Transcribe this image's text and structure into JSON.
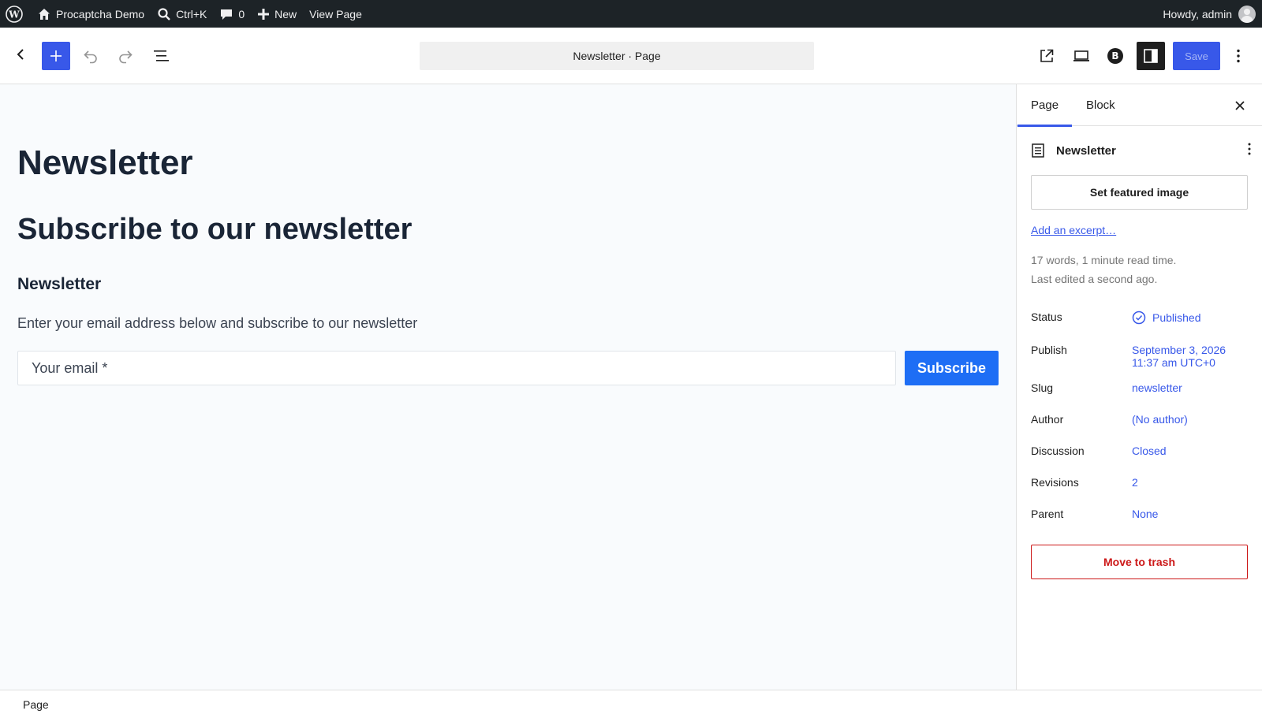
{
  "adminbar": {
    "site_name": "Procaptcha Demo",
    "search_shortcut": "Ctrl+K",
    "comments_count": "0",
    "new_label": "New",
    "view_page": "View Page",
    "greeting": "Howdy, admin"
  },
  "header": {
    "document_title": "Newsletter · Page",
    "save_label": "Save"
  },
  "canvas": {
    "post_title": "Newsletter",
    "heading2": "Subscribe to our newsletter",
    "heading3": "Newsletter",
    "paragraph": "Enter your email address below and subscribe to our newsletter",
    "email_placeholder": "Your email *",
    "subscribe_label": "Subscribe"
  },
  "sidebar": {
    "tabs": [
      {
        "label": "Page",
        "active": true
      },
      {
        "label": "Block",
        "active": false
      }
    ],
    "doc_name": "Newsletter",
    "featured_image_label": "Set featured image",
    "excerpt_link": "Add an excerpt…",
    "stats": "17 words, 1 minute read time.",
    "last_edited": "Last edited a second ago.",
    "properties": [
      {
        "key": "Status",
        "value": "Published"
      },
      {
        "key": "Publish",
        "value": "September 3, 2026",
        "value2": "11:37 am UTC+0"
      },
      {
        "key": "Slug",
        "value": "newsletter"
      },
      {
        "key": "Author",
        "value": "(No author)"
      },
      {
        "key": "Discussion",
        "value": "Closed"
      },
      {
        "key": "Revisions",
        "value": "2"
      },
      {
        "key": "Parent",
        "value": "None"
      }
    ],
    "trash_label": "Move to trash"
  },
  "footer": {
    "breadcrumb": "Page"
  },
  "colors": {
    "accent": "#3858e9",
    "admin_bar": "#1d2327",
    "subscribe": "#1e6ef5",
    "danger": "#cc1818"
  }
}
